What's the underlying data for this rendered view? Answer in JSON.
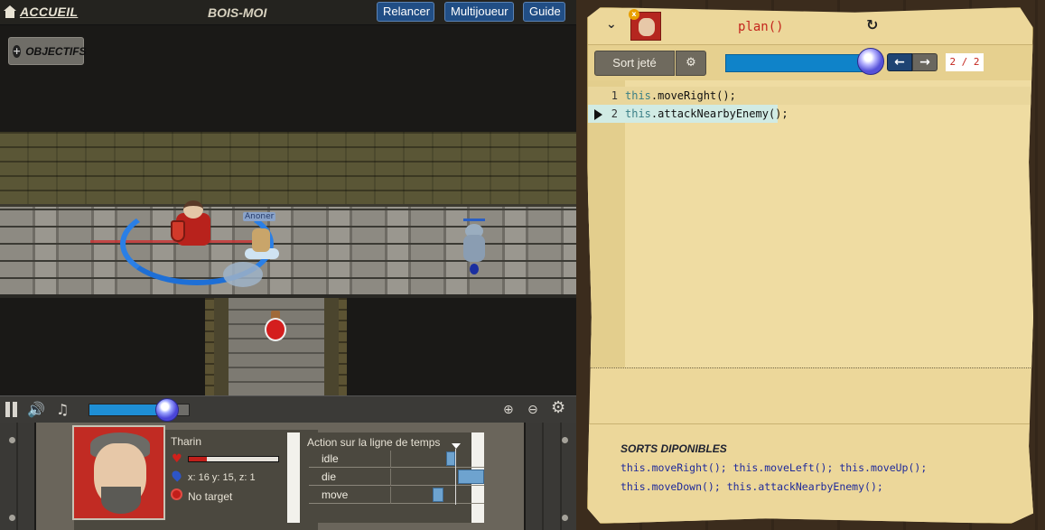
{
  "topbar": {
    "home_label": "ACCUEIL",
    "level_title": "BOIS-MOI",
    "restart_label": "Relancer",
    "multiplayer_label": "Multijoueur",
    "guide_label": "Guide"
  },
  "world": {
    "objectives_label": "OBJECTIFS",
    "ally_name": "Anoner"
  },
  "controls": {
    "playback_progress": 0.78
  },
  "hud": {
    "hero_name": "Tharin",
    "health_fraction": 0.2,
    "coords": "x: 16 y: 15, z: 1",
    "target": "No target",
    "timeline_title": "Action sur la ligne de temps",
    "actions": [
      {
        "label": "idle",
        "start": 0.59,
        "end": 0.69
      },
      {
        "label": "die",
        "start": 0.72,
        "end": 1.0
      },
      {
        "label": "move",
        "start": 0.45,
        "end": 0.56
      }
    ]
  },
  "spell": {
    "name": "plan()",
    "cast_label": "Sort jeté",
    "step_counter": "2 / 2",
    "step_progress": 1.0,
    "code_lines": [
      {
        "number": "1",
        "this": "this",
        "rest": ".moveRight();"
      },
      {
        "number": "2",
        "this": "this",
        "rest": ".attackNearbyEnemy();"
      }
    ],
    "palette_title": "SORTS DIPONIBLES",
    "palette_rows": [
      "this.moveRight(); this.moveLeft(); this.moveUp();",
      "this.moveDown(); this.attackNearbyEnemy();"
    ]
  },
  "colors": {
    "accent_blue": "#214e85",
    "health_red": "#c01f1a",
    "parchment": "#ecd79a",
    "spell_name": "#c4251d"
  },
  "icons": [
    "home-icon",
    "plus-icon",
    "pause-icon",
    "volume-icon",
    "music-icon",
    "zoom-in-icon",
    "zoom-out-icon",
    "settings-icon",
    "heart-icon",
    "location-pin-icon",
    "target-icon",
    "chevron-down-icon",
    "reload-icon",
    "gear-icon",
    "arrow-left-icon",
    "arrow-right-icon"
  ]
}
